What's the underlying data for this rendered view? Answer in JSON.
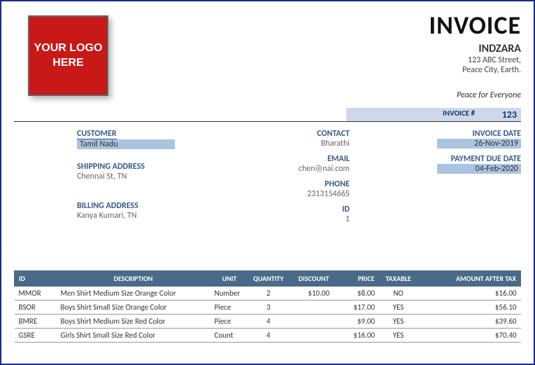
{
  "header": {
    "logo_text": "YOUR LOGO HERE",
    "title": "INVOICE",
    "company": "INDZARA",
    "addr1": "123 ABC Street,",
    "addr2": "Peace City, Earth.",
    "tagline": "Peace for Everyone",
    "invno_label": "INVOICE #",
    "invno_val": "123"
  },
  "customer": {
    "customer_lbl": "CUSTOMER",
    "customer_val": "Tamil Nadu",
    "ship_lbl": "SHIPPING ADDRESS",
    "ship_val": "Chennai St, TN",
    "bill_lbl": "BILLING ADDRESS",
    "bill_val": "Kanya Kumari, TN"
  },
  "contact": {
    "contact_lbl": "CONTACT",
    "contact_val": "Bharathi",
    "email_lbl": "EMAIL",
    "email_val": "chen@nai.com",
    "phone_lbl": "PHONE",
    "phone_val": "2313154665",
    "id_lbl": "ID",
    "id_val": "1"
  },
  "dates": {
    "invdate_lbl": "INVOICE DATE",
    "invdate_val": "26-Nov-2019",
    "due_lbl": "PAYMENT DUE DATE",
    "due_val": "04-Feb-2020"
  },
  "table": {
    "headers": {
      "id": "ID",
      "desc": "DESCRIPTION",
      "unit": "UNIT",
      "qty": "QUANTITY",
      "disc": "DISCOUNT",
      "price": "PRICE",
      "tax": "TAXABLE",
      "amt": "AMOUNT AFTER TAX"
    },
    "rows": [
      {
        "id": "MMOR",
        "desc": "Men Shirt Medium Size Orange Color",
        "unit": "Number",
        "qty": "2",
        "disc": "$10.00",
        "price": "$8.00",
        "tax": "NO",
        "amt": "$16.00"
      },
      {
        "id": "BSOR",
        "desc": "Boys Shirt Small Size Orange Color",
        "unit": "Piece",
        "qty": "3",
        "disc": "",
        "price": "$17.00",
        "tax": "YES",
        "amt": "$56.10"
      },
      {
        "id": "BMRE",
        "desc": "Boys Shirt Medium Size Red Color",
        "unit": "Piece",
        "qty": "4",
        "disc": "",
        "price": "$9.00",
        "tax": "YES",
        "amt": "$39.60"
      },
      {
        "id": "GSRE",
        "desc": "Girls Shirt Small Size Red Color",
        "unit": "Count",
        "qty": "4",
        "disc": "",
        "price": "$16.00",
        "tax": "YES",
        "amt": "$70.40"
      }
    ]
  }
}
